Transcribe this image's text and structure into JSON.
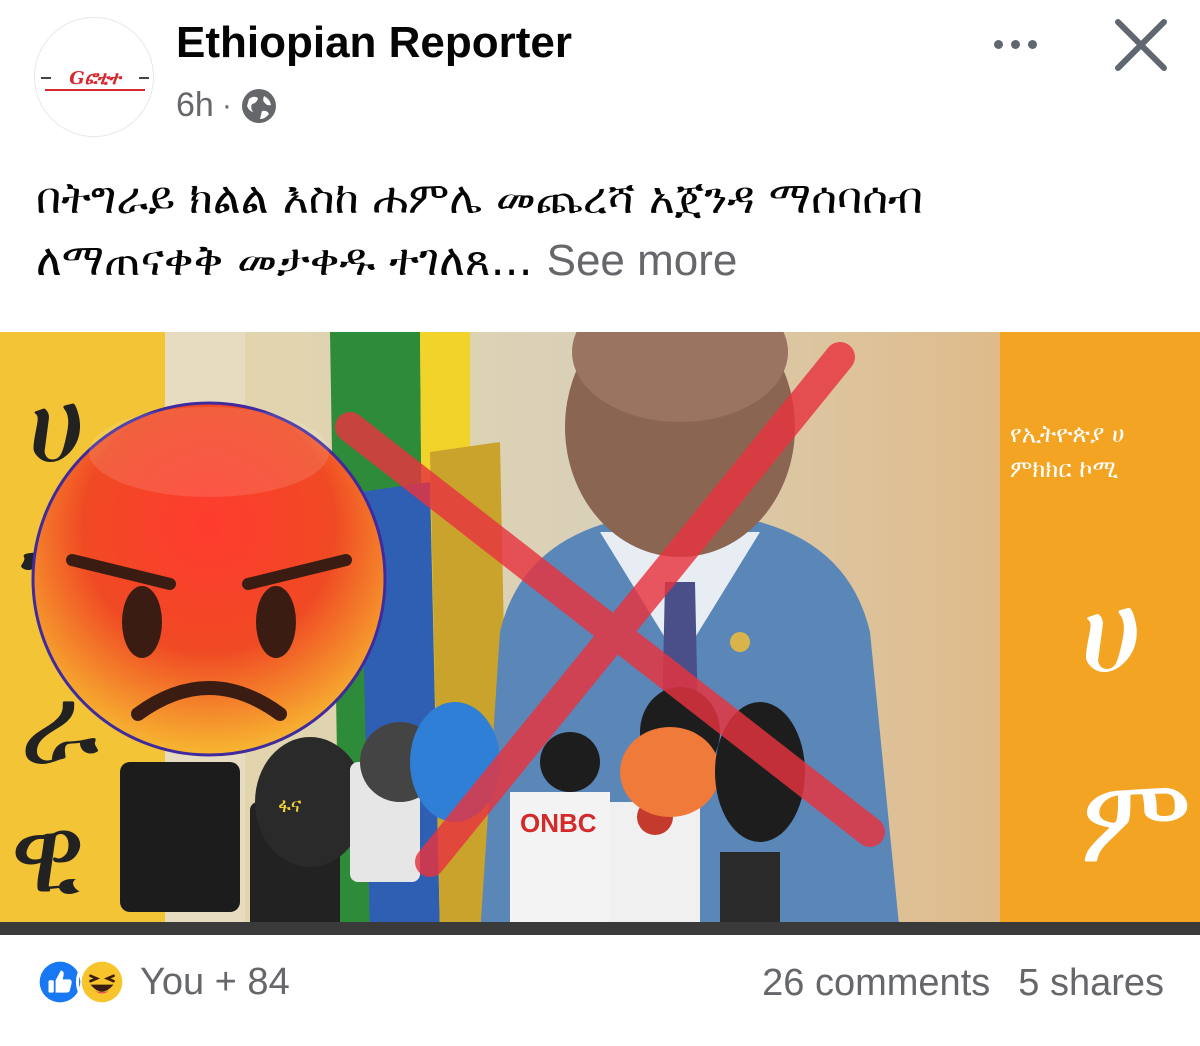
{
  "post": {
    "page_name": "Ethiopian Reporter",
    "logo_text": "Gፎቲተ",
    "time": "6h",
    "separator": "·",
    "audience_icon": "globe-icon",
    "text_line1": "በትግራይ ክልል እስከ ሐምሌ መጨረሻ አጀንዳ ማሰባሰብ",
    "text_line2": "ለማጠናቀቅ መታቀዱ ተገለጸ...",
    "see_more": "See more"
  },
  "photo": {
    "left_banner_letters": [
      "ሀ",
      "ገ",
      "ራ",
      "ዊ"
    ],
    "right_banner_text1": "የኢትዮጵያ ሀ",
    "right_banner_text2": "ምክክር ኮሚ",
    "right_banner_big1": "ሀ",
    "right_banner_big2": "ም",
    "mic_label_onbc": "ONBC",
    "mic_label_1": "ፋና",
    "overlay_emoji": "angry-face-icon",
    "overlay_mark": "red-x-icon"
  },
  "footer": {
    "reaction_icons": [
      "like-icon",
      "haha-icon"
    ],
    "reaction_summary": "You + 84",
    "comments": "26 comments",
    "shares": "5 shares"
  },
  "colors": {
    "name": "#050505",
    "meta": "#65676b",
    "like_blue": "#1877f2",
    "x_red": "#e8343f",
    "banner_orange": "#f5a623"
  }
}
